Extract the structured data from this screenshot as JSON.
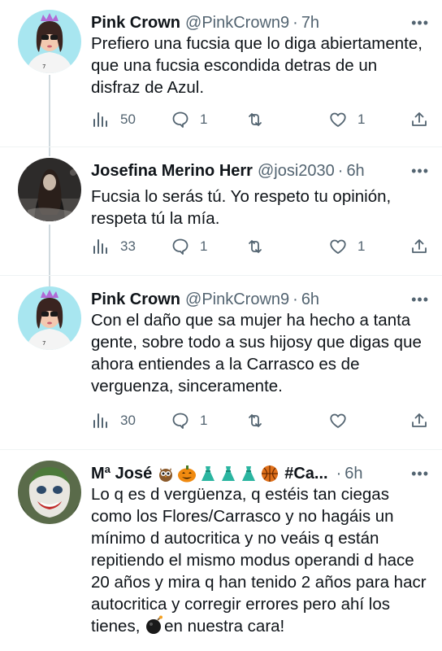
{
  "tweets": [
    {
      "name": "Pink Crown",
      "handle": "@PinkCrown9",
      "time": "7h",
      "text": "Prefiero una fucsia que lo diga abiertamente, que una fucsia escondida detras de un disfraz de Azul.",
      "views": "50",
      "replies": "1",
      "retweets": "",
      "likes": "1"
    },
    {
      "name": "Josefina Merino Herr",
      "handle": "@josi2030",
      "time": "6h",
      "text": "Fucsia lo serás tú. Yo respeto tu opinión, respeta tú la mía.",
      "views": "33",
      "replies": "1",
      "retweets": "",
      "likes": "1"
    },
    {
      "name": "Pink Crown",
      "handle": "@PinkCrown9",
      "time": "6h",
      "text": "Con el daño que sa mujer ha hecho a tanta gente, sobre todo a sus hijosy que digas que ahora entiendes a la Carrasco es de verguenza, sinceramente.",
      "views": "30",
      "replies": "1",
      "retweets": "",
      "likes": ""
    },
    {
      "name": "Mª José",
      "name_suffix": "#Ca...",
      "handle": "",
      "time": "6h",
      "text_before": "Lo q es d vergüenza, q estéis tan ciegas como los Flores/Carrasco y no hagáis un mínimo d autocritica y no veáis q están repitiendo el mismo modus operandi d hace 20 años y mira q han tenido 2 años para hacr autocritica y corregir errores pero ahí los tienes,",
      "text_after": "en nuestra cara!"
    }
  ],
  "colors": {
    "text": "#0f1419",
    "secondary": "#536471",
    "line": "#cfd9de"
  }
}
